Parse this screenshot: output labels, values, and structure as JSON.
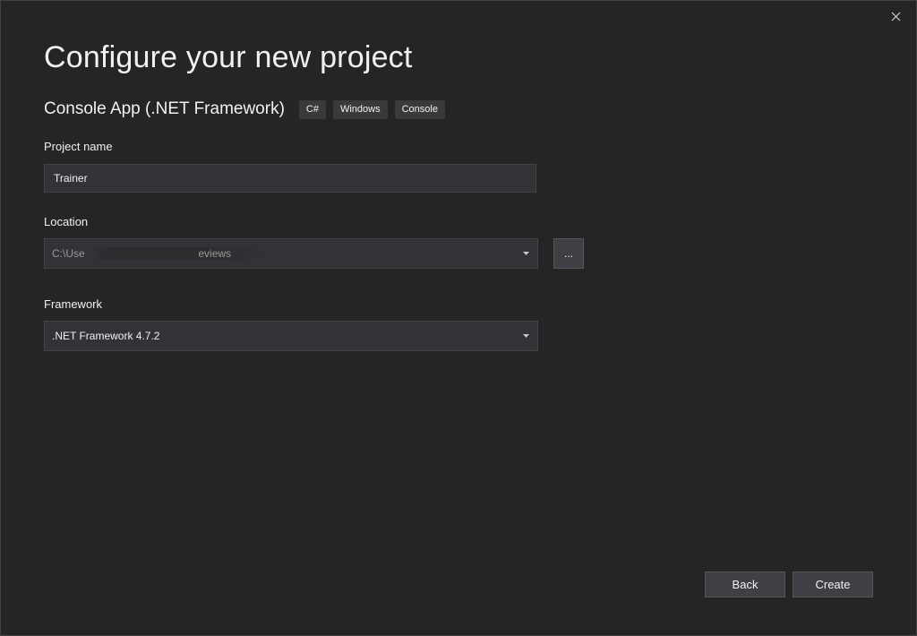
{
  "dialog": {
    "title": "Configure your new project",
    "template_name": "Console App (.NET Framework)",
    "tags": [
      "C#",
      "Windows",
      "Console"
    ]
  },
  "project_name": {
    "label": "Project name",
    "value": "Trainer"
  },
  "location": {
    "label": "Location",
    "value": "C:\\Use                                      eviews",
    "browse_label": "..."
  },
  "framework": {
    "label": "Framework",
    "value": ".NET Framework 4.7.2"
  },
  "buttons": {
    "back": "Back",
    "create": "Create"
  },
  "icons": {
    "close": "close-icon",
    "dropdown": "chevron-down-icon"
  },
  "colors": {
    "background": "#252526",
    "input_background": "#333337",
    "button_background": "#3f3f46",
    "text": "#f1f1f1"
  }
}
